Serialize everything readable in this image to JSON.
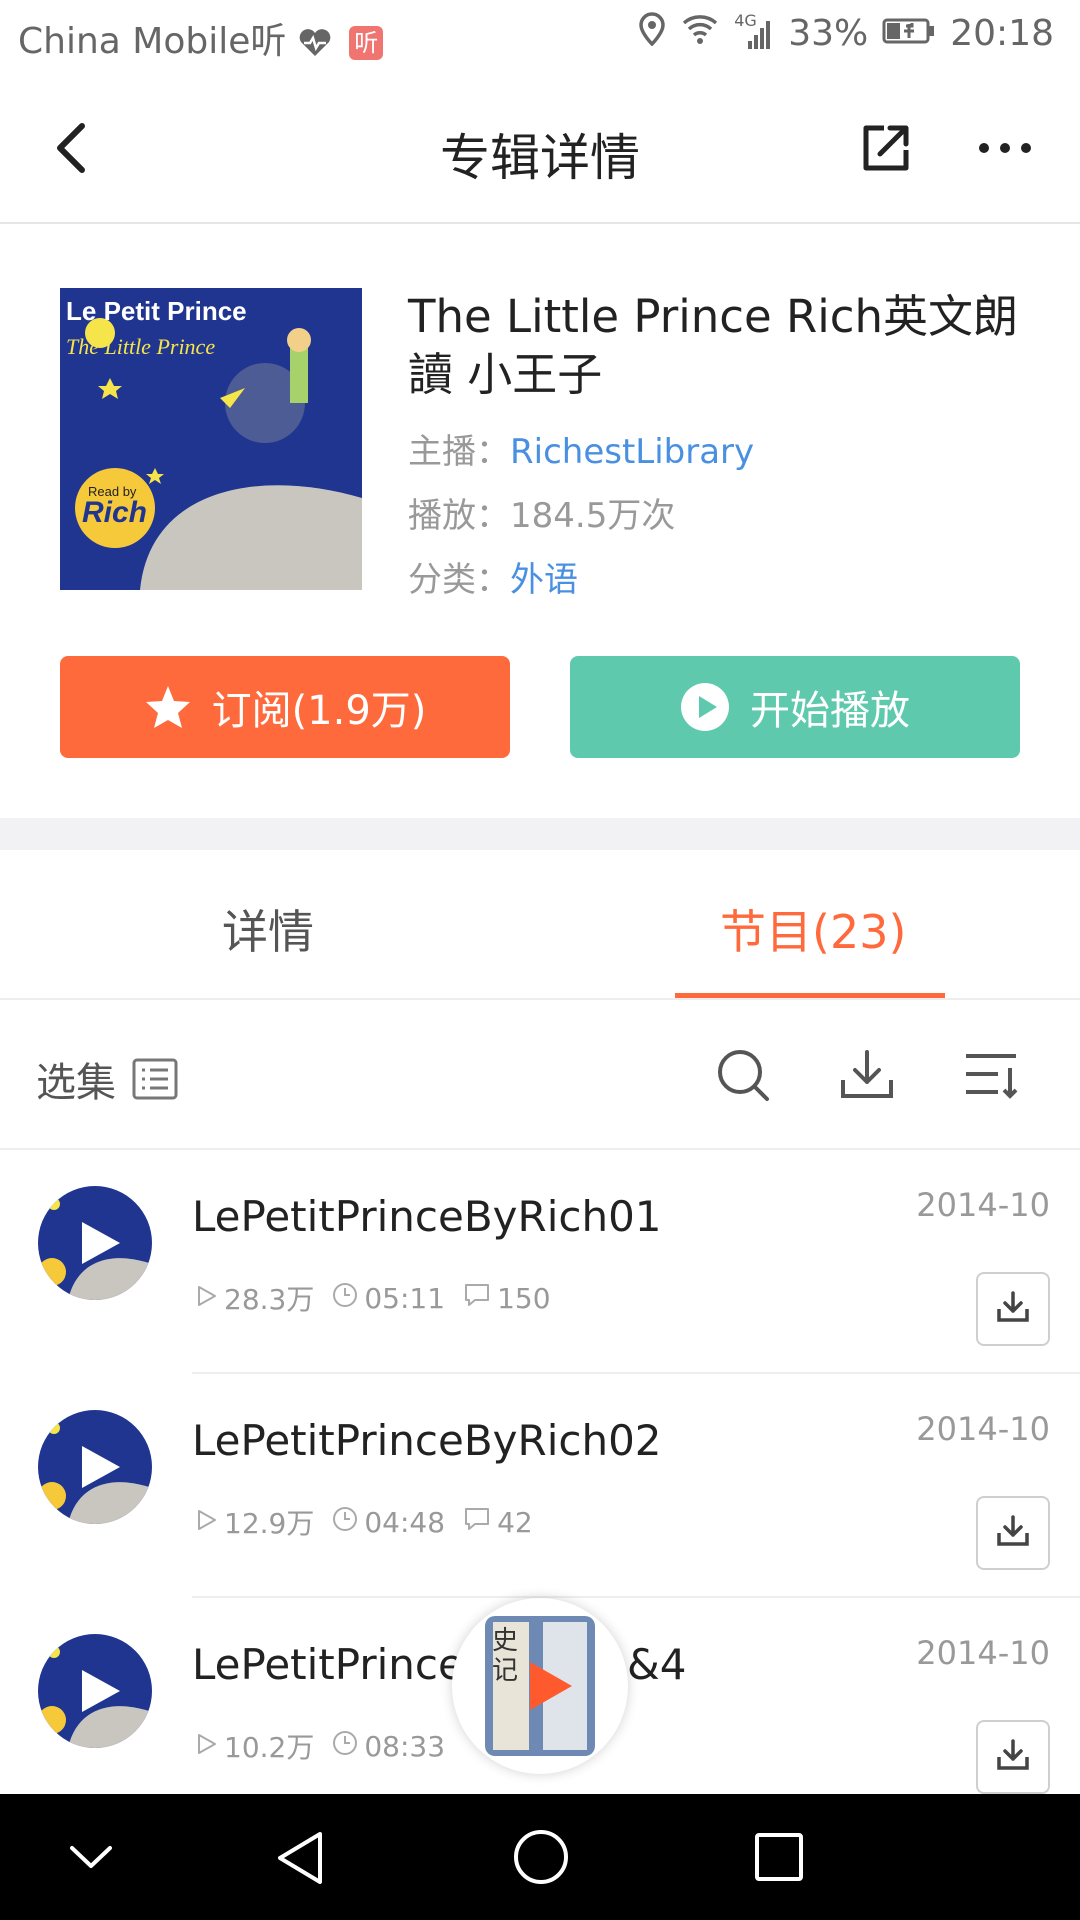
{
  "status_bar": {
    "carrier": "China Mobile听",
    "app_badge": "听",
    "signal_label": "4G",
    "battery_percent": "33%",
    "time": "20:18"
  },
  "header": {
    "title": "专辑详情",
    "back_icon": "chevron-left-icon",
    "share_icon": "share-external-icon",
    "more_icon": "more-horizontal-icon"
  },
  "album": {
    "cover_text_line1": "Le Petit Prince",
    "cover_text_line2": "The Little Prince",
    "cover_badge_small": "Read by",
    "cover_badge_big": "Rich",
    "title": "The Little Prince Rich英文朗讀 小王子",
    "host_label": "主播：",
    "host_value": "RichestLibrary",
    "plays_label": "播放：",
    "plays_value": "184.5万次",
    "category_label": "分类：",
    "category_value": "外语"
  },
  "actions": {
    "subscribe_label": "订阅(1.9万)",
    "play_label": "开始播放"
  },
  "tabs": {
    "detail": "详情",
    "episodes": "节目(23)"
  },
  "toolbar": {
    "select_label": "选集"
  },
  "episodes": [
    {
      "title": "LePetitPrinceByRich01",
      "date": "2014-10",
      "plays": "28.3万",
      "duration": "05:11",
      "comments": "150"
    },
    {
      "title": "LePetitPrinceByRich02",
      "date": "2014-10",
      "plays": "12.9万",
      "duration": "04:48",
      "comments": "42"
    },
    {
      "title": "LePetitPrince",
      "title_suffix": "&4",
      "date": "2014-10",
      "plays": "10.2万",
      "duration": "08:33"
    }
  ],
  "floating_player": {
    "book_text": "史记"
  },
  "colors": {
    "accent": "#ff6a3d",
    "play_green": "#5ec9ac",
    "link_blue": "#4a90e2",
    "cover_blue": "#1f3590"
  }
}
